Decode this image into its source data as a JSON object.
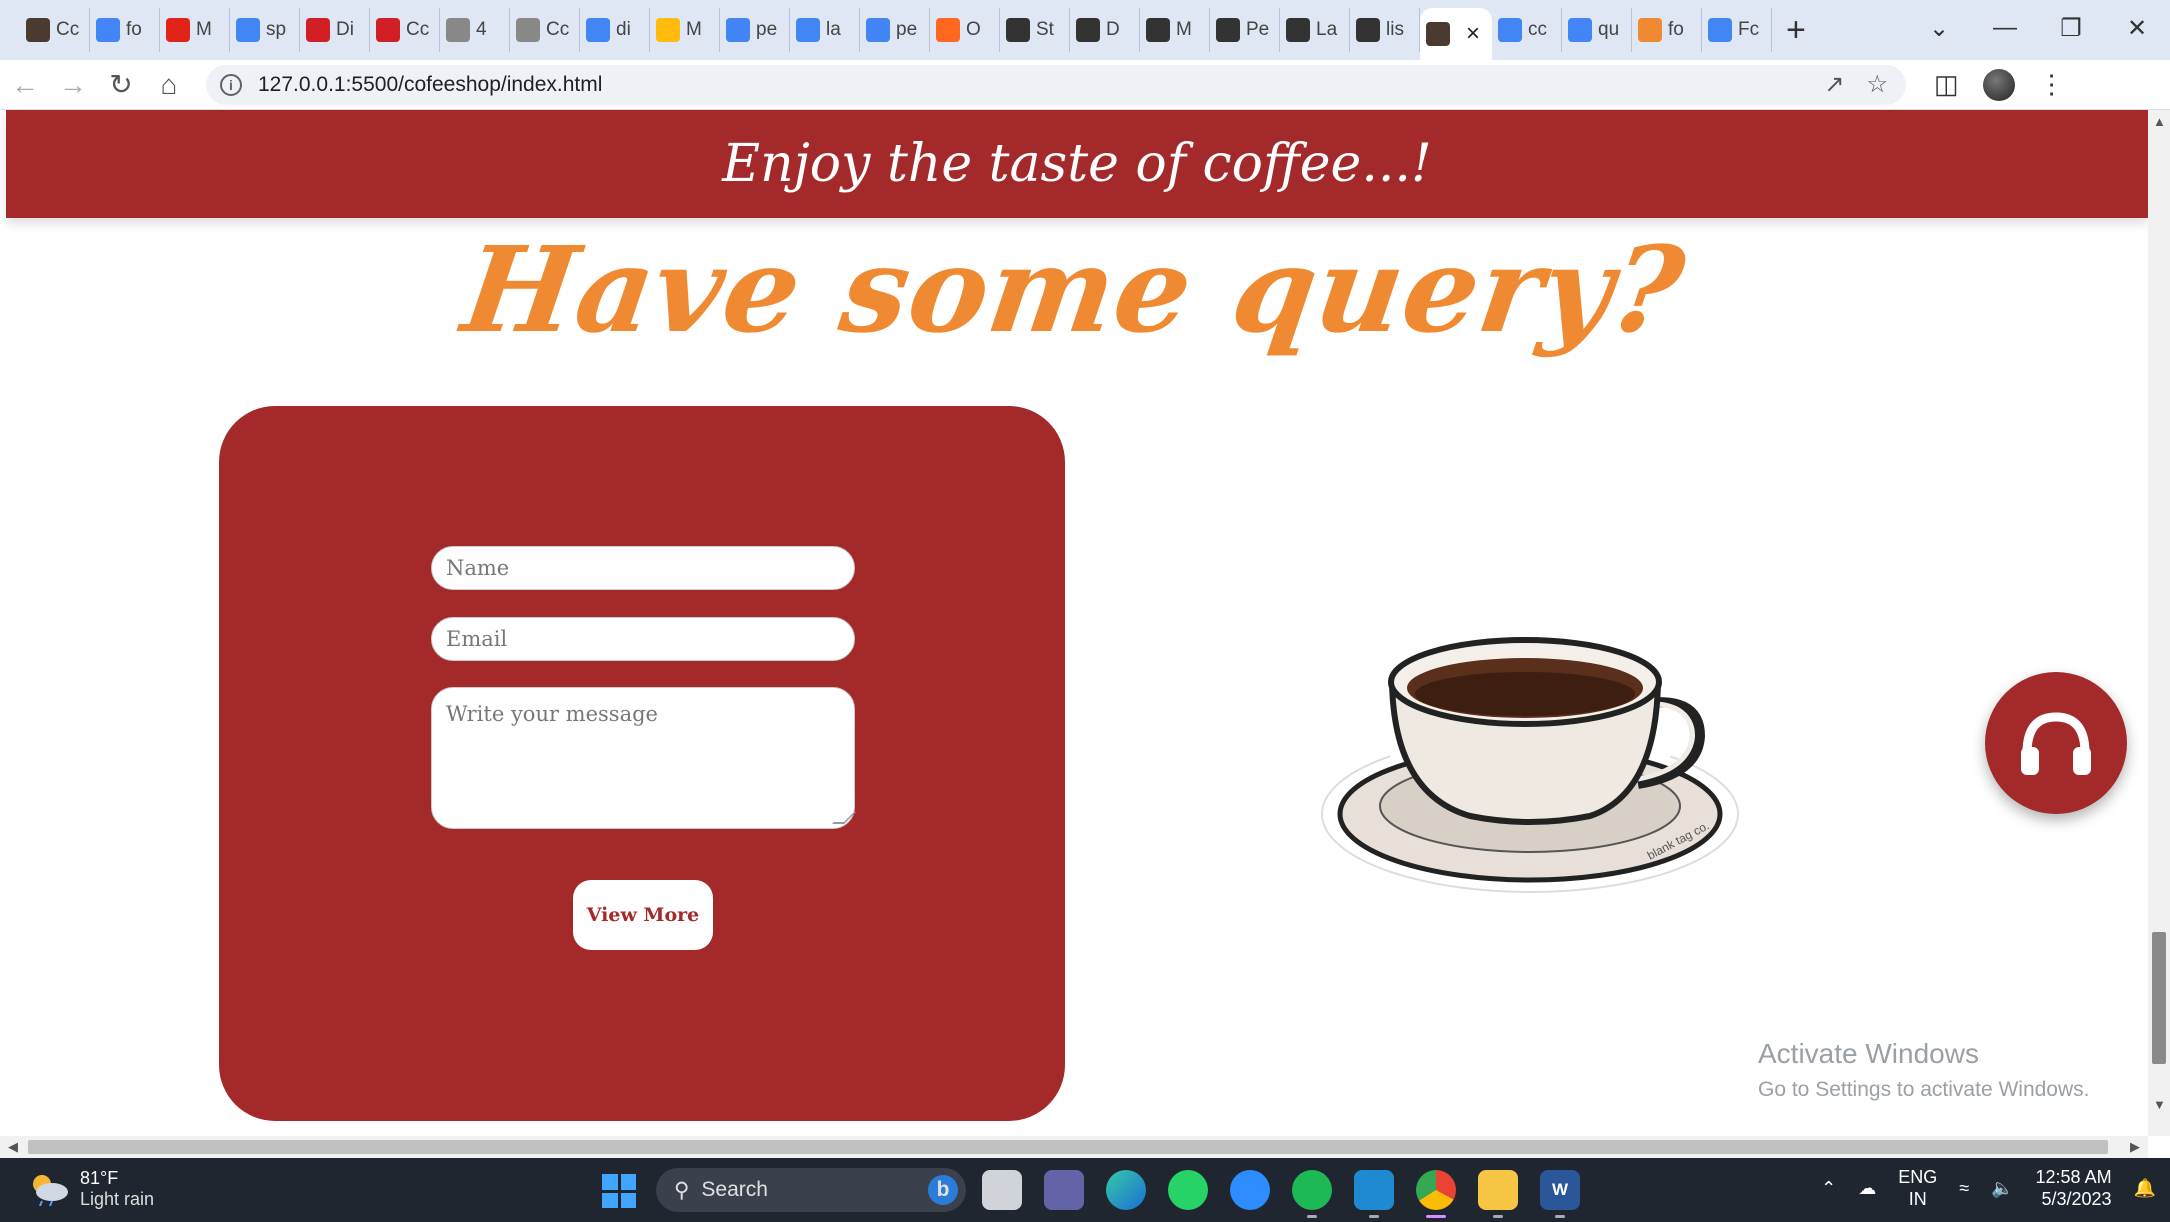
{
  "browser": {
    "tabs": [
      {
        "label": "Cc",
        "icon": "coffee-photo-icon",
        "color": "#4a3a30"
      },
      {
        "label": "fo",
        "icon": "google-icon",
        "color": "#4285f4"
      },
      {
        "label": "M",
        "icon": "multicolor-logo-icon",
        "color": "#e2231a"
      },
      {
        "label": "sp",
        "icon": "google-icon",
        "color": "#4285f4"
      },
      {
        "label": "Di",
        "icon": "red-leaf-icon",
        "color": "#d21f26"
      },
      {
        "label": "Cc",
        "icon": "red-leaf-icon",
        "color": "#d21f26"
      },
      {
        "label": "4",
        "icon": "cup-icon",
        "color": "#888888"
      },
      {
        "label": "Cc",
        "icon": "cup-icon",
        "color": "#888888"
      },
      {
        "label": "di",
        "icon": "google-icon",
        "color": "#4285f4"
      },
      {
        "label": "M",
        "icon": "mcdonalds-icon",
        "color": "#ffbc0d"
      },
      {
        "label": "pe",
        "icon": "google-icon",
        "color": "#4285f4"
      },
      {
        "label": "la",
        "icon": "google-icon",
        "color": "#4285f4"
      },
      {
        "label": "pe",
        "icon": "google-icon",
        "color": "#4285f4"
      },
      {
        "label": "O",
        "icon": "dunkin-icon",
        "color": "#ff671f"
      },
      {
        "label": "St",
        "icon": "wikipedia-icon",
        "color": "#333333"
      },
      {
        "label": "D",
        "icon": "wikipedia-icon",
        "color": "#333333"
      },
      {
        "label": "M",
        "icon": "wikipedia-icon",
        "color": "#333333"
      },
      {
        "label": "Pe",
        "icon": "wikipedia-icon",
        "color": "#333333"
      },
      {
        "label": "La",
        "icon": "wikipedia-icon",
        "color": "#333333"
      },
      {
        "label": "lis",
        "icon": "globe-icon",
        "color": "#333333"
      },
      {
        "label": "",
        "icon": "coffee-photo-icon",
        "color": "#4a3a30",
        "active": true
      },
      {
        "label": "cc",
        "icon": "google-icon",
        "color": "#4285f4"
      },
      {
        "label": "qu",
        "icon": "google-icon",
        "color": "#4285f4"
      },
      {
        "label": "fo",
        "icon": "code-icon",
        "color": "#f08a32"
      },
      {
        "label": "Fc",
        "icon": "flag-icon",
        "color": "#4285f4"
      }
    ],
    "url": "127.0.0.1:5500/cofeeshop/index.html"
  },
  "page": {
    "tagline": "Enjoy the taste of coffee...!",
    "query_title": "Have some query?",
    "form": {
      "name_placeholder": "Name",
      "email_placeholder": "Email",
      "message_placeholder": "Write your message",
      "button_label": "View More"
    },
    "cup_sticker_text": "blank tag co.",
    "colors": {
      "brand": "#a3292b",
      "accent": "#f08a32"
    }
  },
  "watermark": {
    "title": "Activate Windows",
    "subtitle": "Go to Settings to activate Windows."
  },
  "taskbar": {
    "weather_temp": "81°F",
    "weather_condition": "Light rain",
    "search_label": "Search",
    "lang_top": "ENG",
    "lang_bottom": "IN",
    "time": "12:58 AM",
    "date": "5/3/2023"
  }
}
